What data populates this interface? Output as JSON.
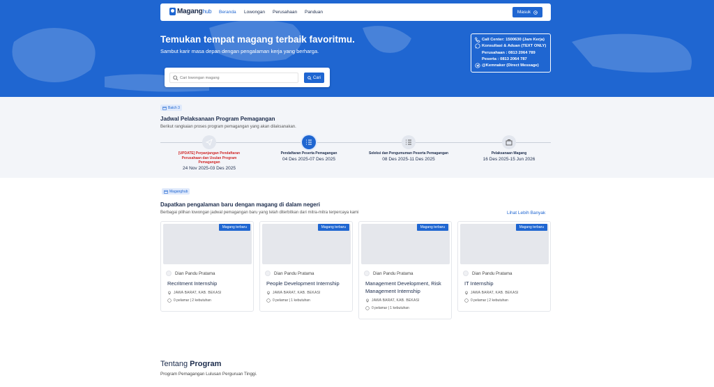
{
  "nav": {
    "logo_main": "Magang",
    "logo_hub": "hub",
    "links": [
      "Beranda",
      "Lowongan",
      "Perusahaan",
      "Panduan"
    ],
    "login_label": "Masuk"
  },
  "hero": {
    "title": "Temukan tempat magang terbaik favoritmu.",
    "subtitle": "Sambut karir masa depan dengan pengalaman kerja yang berharga.",
    "search_placeholder": "Cari lowongan magang",
    "search_button": "Cari"
  },
  "contact": {
    "call_center": "Call Center: 1500630 (Jam Kerja)",
    "consult": "Konsultasi & Aduan (TEXT ONLY)",
    "company": "Perusahaan : 0813 2064 789",
    "participant": "Peserta : 0813 2064 787",
    "telegram": "@Kemnaker (Direct Message)"
  },
  "schedule": {
    "badge": "Batch 3",
    "title": "Jadwal Pelaksanaan Program Pemagangan",
    "desc": "Berikut rangkaian proses program pemagangan yang akan dilaksanakan.",
    "steps": [
      {
        "label": "[UPDATE] Perpanjangan Pendaftaran Perusahaan dan Usulan Program Pemagangan",
        "date": "24 Nov 2025-03 Des 2025"
      },
      {
        "label": "Pendaftaran Peserta Pemagangan",
        "date": "04 Des 2025-07 Des 2025"
      },
      {
        "label": "Seleksi dan Pengumuman Peserta Pemagangan",
        "date": "08 Des 2025-11 Des 2025"
      },
      {
        "label": "Pelaksanaan Magang",
        "date": "16 Des 2025-15 Jun 2026"
      }
    ]
  },
  "internships": {
    "badge": "Maganghub",
    "title": "Dapatkan pengalaman baru dengan magang di dalam negeri",
    "desc": "Berbagai pilihan lowongan jadwal pemagangan baru yang telah diterbitkan dari mitra-mitra terpercaya kami",
    "see_more": "Lihat Lebih Banyak",
    "tag": "Magang terbaru",
    "cards": [
      {
        "author": "Dian Pandu Pratama",
        "title": "Recritment Internship",
        "location": "JAWA BARAT, KAB. BEKASI",
        "meta": "0 pelamar | 2 kebutuhan"
      },
      {
        "author": "Dian Pandu Pratama",
        "title": "People Development Internship",
        "location": "JAWA BARAT, KAB. BEKASI",
        "meta": "0 pelamar | 1 kebutuhan"
      },
      {
        "author": "Dian Pandu Pratama",
        "title": "Management Development, Risk Management Internship",
        "location": "JAWA BARAT, KAB. BEKASI",
        "meta": "0 pelamar | 1 kebutuhan"
      },
      {
        "author": "Dian Pandu Pratama",
        "title": "IT Internship",
        "location": "JAWA BARAT, KAB. BEKASI",
        "meta": "0 pelamar | 2 kebutuhan"
      }
    ]
  },
  "about": {
    "title_a": "Tentang",
    "title_b": "Program",
    "desc": "Program Pemagangan Lulusan Perguruan Tinggi."
  },
  "colors": {
    "primary": "#1f66d1",
    "dark_text": "#1b2b4b",
    "alert": "#d02a2a"
  }
}
